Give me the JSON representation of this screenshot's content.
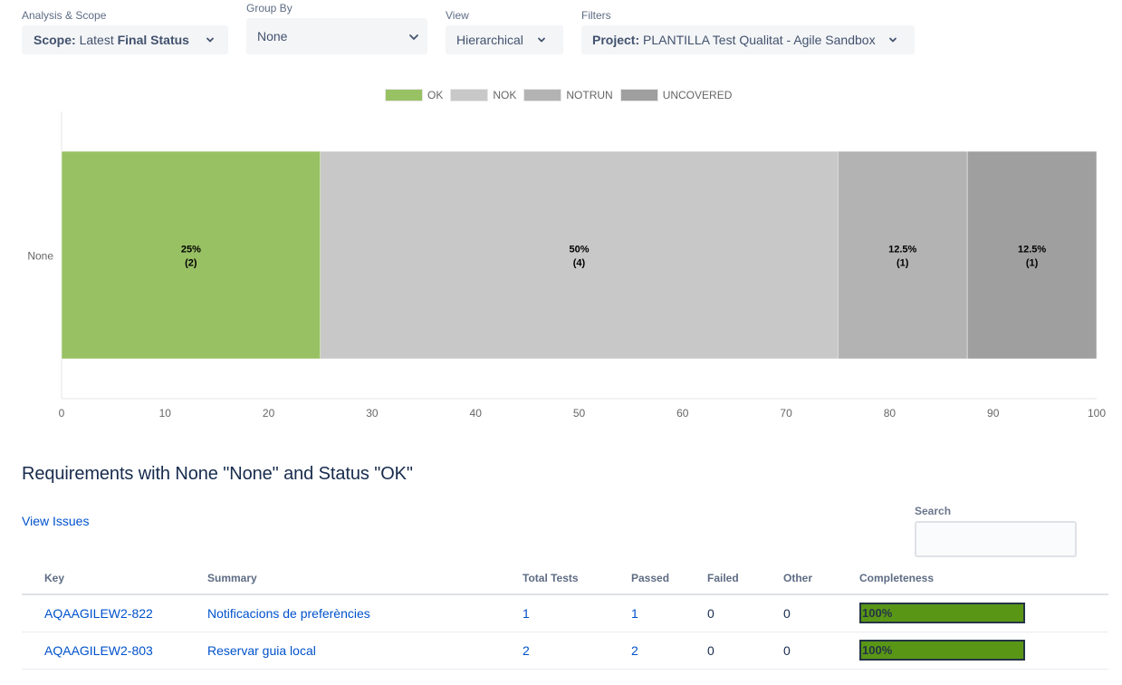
{
  "filters": {
    "analysis_scope": {
      "label": "Analysis & Scope",
      "prefix": "Scope:",
      "value_light": "Latest",
      "value_bold": "Final Status"
    },
    "group_by": {
      "label": "Group By",
      "value": "None"
    },
    "view": {
      "label": "View",
      "value": "Hierarchical"
    },
    "filters": {
      "label": "Filters",
      "prefix": "Project:",
      "value": "PLANTILLA Test Qualitat - Agile Sandbox"
    }
  },
  "chart_data": {
    "type": "bar",
    "orientation": "horizontal",
    "stacked": true,
    "title": "",
    "xlabel": "",
    "ylabel": "",
    "categories": [
      "None"
    ],
    "xlim": [
      0,
      100
    ],
    "xticks": [
      0,
      10,
      20,
      30,
      40,
      50,
      60,
      70,
      80,
      90,
      100
    ],
    "grid": false,
    "legend_position": "top-center",
    "series": [
      {
        "name": "OK",
        "color": "#98c164",
        "values": [
          25
        ],
        "counts": [
          2
        ],
        "labels": [
          "25%",
          "(2)"
        ]
      },
      {
        "name": "NOK",
        "color": "#c8c8c8",
        "values": [
          50
        ],
        "counts": [
          4
        ],
        "labels": [
          "50%",
          "(4)"
        ]
      },
      {
        "name": "NOTRUN",
        "color": "#b3b3b3",
        "values": [
          12.5
        ],
        "counts": [
          1
        ],
        "labels": [
          "12.5%",
          "(1)"
        ]
      },
      {
        "name": "UNCOVERED",
        "color": "#9f9f9f",
        "values": [
          12.5
        ],
        "counts": [
          1
        ],
        "labels": [
          "12.5%",
          "(1)"
        ]
      }
    ]
  },
  "requirements": {
    "title": "Requirements with None \"None\" and Status \"OK\"",
    "view_issues_label": "View Issues",
    "search": {
      "label": "Search",
      "value": "",
      "placeholder": ""
    },
    "columns": [
      "Key",
      "Summary",
      "Total Tests",
      "Passed",
      "Failed",
      "Other",
      "Completeness"
    ],
    "rows": [
      {
        "key": "AQAAGILEW2-822",
        "summary": "Notificacions de preferències",
        "total": "1",
        "passed": "1",
        "failed": "0",
        "other": "0",
        "completeness": "100%",
        "completeness_value": 100
      },
      {
        "key": "AQAAGILEW2-803",
        "summary": "Reservar guia local",
        "total": "2",
        "passed": "2",
        "failed": "0",
        "other": "0",
        "completeness": "100%",
        "completeness_value": 100
      }
    ],
    "completeness_color": "#5a9616"
  }
}
